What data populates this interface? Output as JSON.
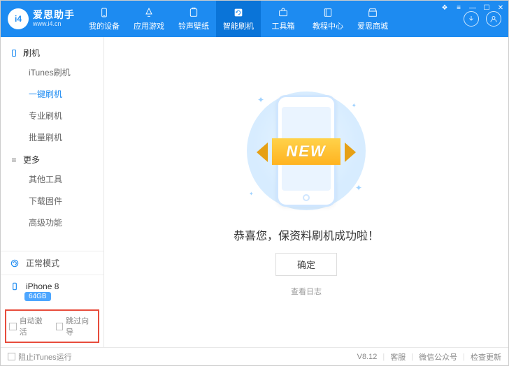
{
  "app": {
    "title": "爱思助手",
    "url": "www.i4.cn",
    "logo_text": "i4"
  },
  "nav": {
    "items": [
      {
        "label": "我的设备",
        "icon": "phone"
      },
      {
        "label": "应用游戏",
        "icon": "apps"
      },
      {
        "label": "铃声壁纸",
        "icon": "music"
      },
      {
        "label": "智能刷机",
        "icon": "refresh",
        "active": true
      },
      {
        "label": "工具箱",
        "icon": "toolbox"
      },
      {
        "label": "教程中心",
        "icon": "book"
      },
      {
        "label": "爱思商城",
        "icon": "store"
      }
    ]
  },
  "sidebar": {
    "groups": [
      {
        "title": "刷机",
        "icon": "phone-outline",
        "items": [
          {
            "label": "iTunes刷机"
          },
          {
            "label": "一键刷机",
            "active": true
          },
          {
            "label": "专业刷机"
          },
          {
            "label": "批量刷机"
          }
        ]
      },
      {
        "title": "更多",
        "icon": "list",
        "items": [
          {
            "label": "其他工具"
          },
          {
            "label": "下载固件"
          },
          {
            "label": "高级功能"
          }
        ]
      }
    ],
    "mode": {
      "label": "正常模式"
    },
    "device": {
      "name": "iPhone 8",
      "storage": "64GB"
    },
    "options": {
      "auto_activate": "自动激活",
      "skip_guide": "跳过向导"
    }
  },
  "main": {
    "ribbon": "NEW",
    "success": "恭喜您，保资料刷机成功啦！",
    "ok": "确定",
    "view_log": "查看日志"
  },
  "footer": {
    "block_itunes": "阻止iTunes运行",
    "version": "V8.12",
    "support": "客服",
    "wechat": "微信公众号",
    "update": "检查更新"
  }
}
